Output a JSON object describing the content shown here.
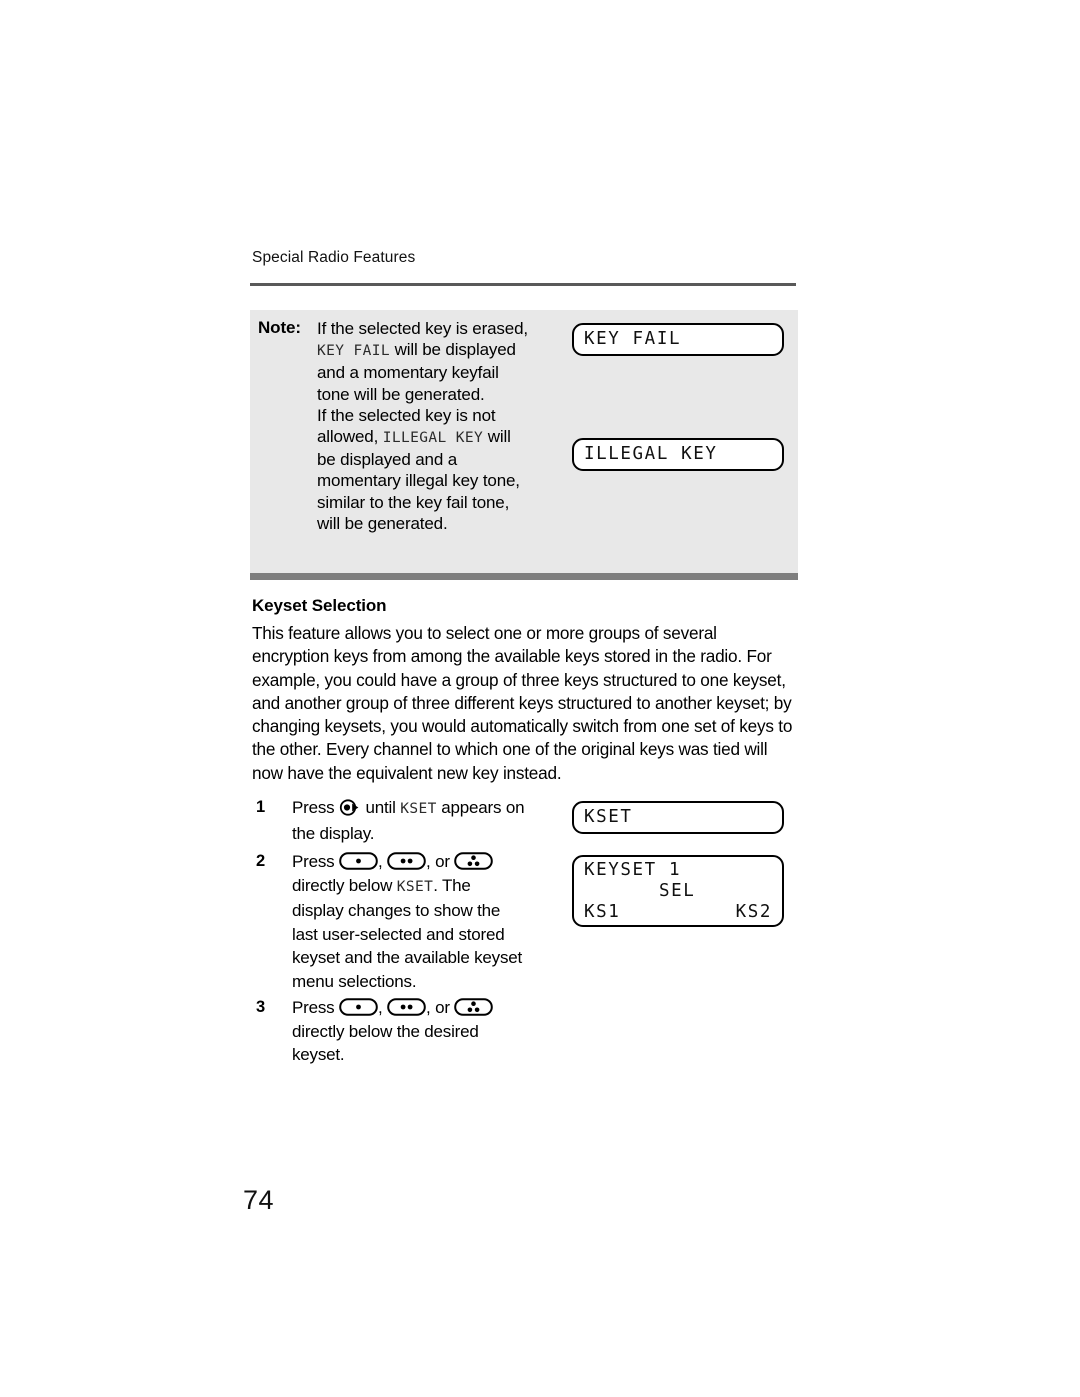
{
  "page": {
    "running_header": "Special Radio Features",
    "folio": "74"
  },
  "note": {
    "label": "Note:",
    "paragraph_1_part_1": "If the selected key is erased, ",
    "paragraph_1_code": "KEY FAIL",
    "paragraph_1_part_2": " will be displayed and a momentary keyfail tone will be generated.",
    "paragraph_2_part_1": "If the selected key is not allowed, ",
    "paragraph_2_code": "ILLEGAL KEY",
    "paragraph_2_part_2": " will be displayed and a momentary illegal key tone, similar to the key fail tone, will be generated."
  },
  "displays": {
    "key_fail": {
      "line1": "KEY FAIL"
    },
    "illegal_key": {
      "line1": "ILLEGAL KEY"
    },
    "kset": {
      "line1": "KSET"
    },
    "keyset_menu": {
      "line1": "KEYSET 1",
      "line2": "SEL",
      "line3_left": "KS1",
      "line3_right": "KS2"
    }
  },
  "section": {
    "heading": "Keyset Selection",
    "body": "This feature allows you to select one or more groups of several encryption keys from among the available keys stored in the radio. For example, you could have a group of three keys structured to one keyset, and another group of three different keys structured to another keyset; by changing keysets, you would automatically switch from one set of keys to the other. Every channel to which one of the original keys was tied will now have the equivalent new key instead."
  },
  "steps": [
    {
      "number": "1",
      "text_before_icon": "Press ",
      "icon": "menu-select-key-icon",
      "text_after_icon_1": " until ",
      "code": "KSET",
      "text_after_icon_2": " appears on the display."
    },
    {
      "number": "2",
      "text_before_icon": "Press ",
      "icons": [
        "soft-key-one-dot-icon",
        "soft-key-two-dot-icon",
        "soft-key-three-dot-icon"
      ],
      "separator_1": ", ",
      "separator_2": ", or ",
      "text_after_icons_1": " directly below ",
      "code": "KSET",
      "text_after_icons_2": ". The display changes to show the last user-selected and stored keyset and the available keyset menu selections."
    },
    {
      "number": "3",
      "text_before_icon": "Press ",
      "icons": [
        "soft-key-one-dot-icon",
        "soft-key-two-dot-icon",
        "soft-key-three-dot-icon"
      ],
      "separator_1": ", ",
      "separator_2": ", or ",
      "text_after_icons": " directly below the desired keyset."
    }
  ],
  "colors": {
    "note_background": "#e8e8e8",
    "note_shadow": "#7e7e7e",
    "header_rule": "#595959",
    "text": "#000000",
    "display_border": "#000000"
  }
}
